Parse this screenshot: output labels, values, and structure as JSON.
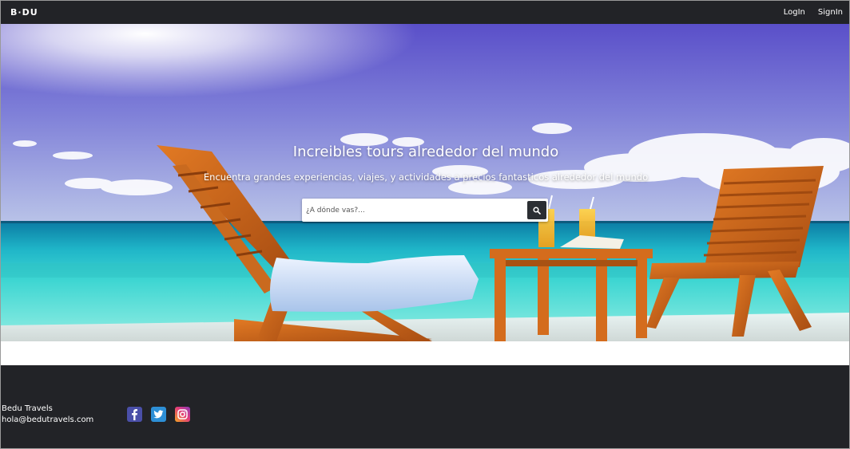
{
  "navbar": {
    "logo_text": "B·DU",
    "links": {
      "login": "LogIn",
      "signin": "SignIn"
    }
  },
  "hero": {
    "title": "Increibles tours alrededor del mundo",
    "subtitle": "Encuentra grandes experiencias, viajes, y actividades a precios fantasticos alrededor del mundo",
    "search": {
      "placeholder": "¿A dónde vas?...",
      "value": "",
      "button_icon": "search-icon"
    }
  },
  "footer": {
    "brand": "Bedu Travels",
    "email": "hola@bedutravels.com",
    "social": [
      {
        "name": "facebook-icon",
        "color": "#4a4fa8"
      },
      {
        "name": "twitter-icon",
        "color": "#2d8fd6"
      },
      {
        "name": "instagram-icon",
        "color": "#e23b7a"
      }
    ]
  },
  "colors": {
    "dark": "#222327",
    "search_button": "#2b2e33"
  }
}
